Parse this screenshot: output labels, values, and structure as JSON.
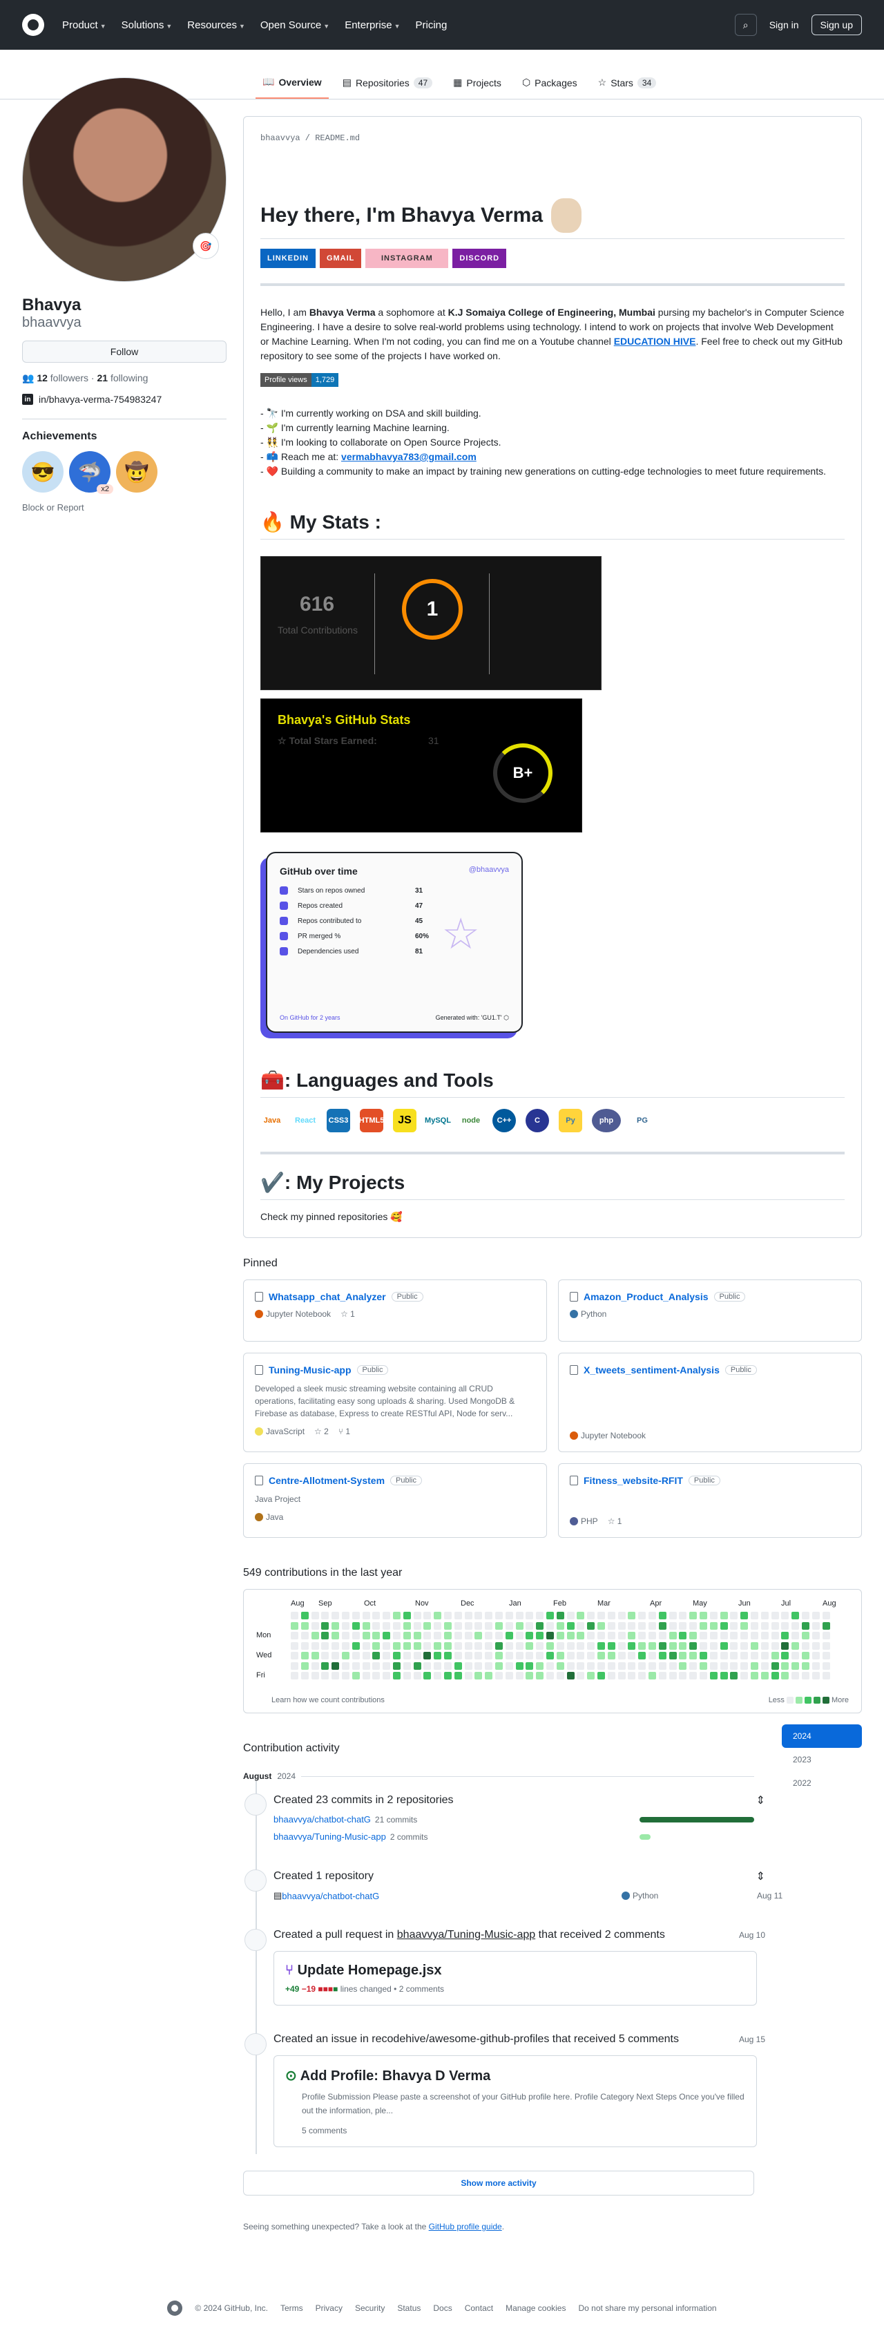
{
  "nav": {
    "items": [
      "Product",
      "Solutions",
      "Resources",
      "Open Source",
      "Enterprise",
      "Pricing"
    ],
    "signin": "Sign in",
    "signup": "Sign up"
  },
  "tabs": [
    {
      "label": "Overview",
      "count": ""
    },
    {
      "label": "Repositories",
      "count": "47"
    },
    {
      "label": "Projects",
      "count": ""
    },
    {
      "label": "Packages",
      "count": ""
    },
    {
      "label": "Stars",
      "count": "34"
    }
  ],
  "profile": {
    "name": "Bhavya",
    "login": "bhaavvya",
    "follow": "Follow",
    "followers": "12",
    "followers_label": "followers",
    "following": "21",
    "following_label": "following",
    "linkedin": "in/bhavya-verma-754983247",
    "achievements_title": "Achievements",
    "ach_count": "x2",
    "block": "Block or Report"
  },
  "readme": {
    "path_user": "bhaavvya",
    "path_file": "README",
    "path_ext": ".md",
    "title": "Hey there, I'm Bhavya Verma",
    "badges": [
      {
        "label": "LINKEDIN",
        "color": "#0a66c2"
      },
      {
        "label": "GMAIL",
        "color": "#d14836"
      },
      {
        "label": "INSTAGRAM",
        "color": "#f7b6c5"
      },
      {
        "label": "DISCORD",
        "color": "#7b1fa2"
      }
    ],
    "intro_1": "Hello, I am ",
    "intro_name": "Bhavya Verma",
    "intro_2": " a sophomore at ",
    "intro_college": "K.J Somaiya College of Engineering, Mumbai",
    "intro_3": " pursing my bachelor's in Computer Science Engineering. I have a desire to solve real-world problems using technology. I intend to work on projects that involve Web Development or Machine Learning. When I'm not coding, you can find me on a Youtube channel ",
    "intro_channel": "EDUCATION HIVE",
    "intro_4": ". Feel free to check out my GitHub repository to see some of the projects I have worked on.",
    "views_label": "Profile views",
    "views_value": "1,729",
    "bullets": [
      "- 🔭 I'm currently working on DSA and skill building.",
      "- 🌱 I'm currently learning Machine learning.",
      "- 👯 I'm looking to collaborate on Open Source Projects.",
      "- 📫 Reach me at: ",
      "- ❤️ Building a community to make an impact by training new generations on cutting-edge technologies to meet future requirements."
    ],
    "email": "vermabhavya783@gmail.com",
    "stats_title": "🔥 My Stats :",
    "streak_total": "616",
    "streak_label": "Total Contributions",
    "streak_current": "1",
    "gh_title": "Bhavya's GitHub Stats",
    "gh_stars_label": "Total Stars Earned:",
    "gh_stars_value": "31",
    "gh_grade": "B+",
    "ot_title": "GitHub over time",
    "ot_user": "@bhaavvya",
    "ot_rows": [
      {
        "label": "Stars on repos owned",
        "value": "31"
      },
      {
        "label": "Repos created",
        "value": "47"
      },
      {
        "label": "Repos contributed to",
        "value": "45"
      },
      {
        "label": "PR merged %",
        "value": "60%"
      },
      {
        "label": "Dependencies used",
        "value": "81"
      }
    ],
    "ot_foot_left": "On GitHub for 2 years",
    "ot_foot_right": "Generated with: 'GU1.T' ⬡",
    "langs_title": "🧰: Languages and Tools",
    "langs": [
      {
        "name": "Java",
        "color": "#e76f00"
      },
      {
        "name": "React",
        "color": "#61dafb"
      },
      {
        "name": "CSS3",
        "color": "#1572b6"
      },
      {
        "name": "HTML5",
        "color": "#e34f26"
      },
      {
        "name": "JS",
        "color": "#f7df1e"
      },
      {
        "name": "MySQL",
        "color": "#00758f"
      },
      {
        "name": "node",
        "color": "#3c873a"
      },
      {
        "name": "C++",
        "color": "#00599c"
      },
      {
        "name": "C",
        "color": "#283593"
      },
      {
        "name": "Py",
        "color": "#ffd43b"
      },
      {
        "name": "php",
        "color": "#4f5b93"
      },
      {
        "name": "PG",
        "color": "#336791"
      }
    ],
    "projects_title": "✔️: My Projects",
    "projects_text": "Check my pinned repositories 🥰"
  },
  "pinned_title": "Pinned",
  "pinned": [
    {
      "name": "Whatsapp_chat_Analyzer",
      "badge": "Public",
      "desc": "",
      "lang": "Jupyter Notebook",
      "lang_color": "#da5b0b",
      "stars": "1",
      "forks": ""
    },
    {
      "name": "Amazon_Product_Analysis",
      "badge": "Public",
      "desc": "",
      "lang": "Python",
      "lang_color": "#3572a5",
      "stars": "",
      "forks": ""
    },
    {
      "name": "Tuning-Music-app",
      "badge": "Public",
      "desc": "Developed a sleek music streaming website containing all CRUD operations, facilitating easy song uploads & sharing. Used MongoDB & Firebase as database, Express to create RESTful API, Node for serv...",
      "lang": "JavaScript",
      "lang_color": "#f1e05a",
      "stars": "2",
      "forks": "1"
    },
    {
      "name": "X_tweets_sentiment-Analysis",
      "badge": "Public",
      "desc": "",
      "lang": "Jupyter Notebook",
      "lang_color": "#da5b0b",
      "stars": "",
      "forks": ""
    },
    {
      "name": "Centre-Allotment-System",
      "badge": "Public",
      "desc": "Java Project",
      "lang": "Java",
      "lang_color": "#b07219",
      "stars": "",
      "forks": ""
    },
    {
      "name": "Fitness_website-RFIT",
      "badge": "Public",
      "desc": "",
      "lang": "PHP",
      "lang_color": "#4f5d95",
      "stars": "1",
      "forks": ""
    }
  ],
  "contrib": {
    "title": "549 contributions in the last year",
    "months": [
      "Aug",
      "Sep",
      "Oct",
      "Nov",
      "Dec",
      "Jan",
      "Feb",
      "Mar",
      "Apr",
      "May",
      "Jun",
      "Jul",
      "Aug"
    ],
    "days": [
      "Mon",
      "Wed",
      "Fri"
    ],
    "learn": "Learn how we count contributions",
    "less": "Less",
    "more": "More"
  },
  "activity": {
    "title": "Contribution activity",
    "month": "August",
    "year": "2024",
    "years": [
      "2024",
      "2023",
      "2022"
    ],
    "ev1_title": "Created 23 commits in 2 repositories",
    "ev1_repos": [
      {
        "name": "bhaavvya/chatbot-chatG",
        "sub": "21 commits"
      },
      {
        "name": "bhaavvya/Tuning-Music-app",
        "sub": "2 commits"
      }
    ],
    "ev2_title": "Created 1 repository",
    "ev2_repo": "bhaavvya/chatbot-chatG",
    "ev2_lang": "Python",
    "ev2_date": "Aug 11",
    "ev3_title_1": "Created a pull request in ",
    "ev3_repo": "bhaavvya/Tuning-Music-app",
    "ev3_title_2": " that received 2 comments",
    "ev3_date": "Aug 10",
    "ev3_pr": "Update Homepage.jsx",
    "ev3_add": "+49",
    "ev3_del": "−19",
    "ev3_lines": "lines changed",
    "ev3_comments": "• 2 comments",
    "ev4_title": "Created an issue in recodehive/awesome-github-profiles that received 5 comments",
    "ev4_date": "Aug 15",
    "ev4_issue": "Add Profile: Bhavya D Verma",
    "ev4_body": "Profile Submission Please paste a screenshot of your GitHub profile here. Profile Category Next Steps Once you've filled out the information, ple...",
    "ev4_comments": "5 comments",
    "show_more": "Show more activity",
    "unexpected_1": "Seeing something unexpected? Take a look at the ",
    "unexpected_link": "GitHub profile guide",
    "unexpected_2": "."
  },
  "footer": [
    "© 2024 GitHub, Inc.",
    "Terms",
    "Privacy",
    "Security",
    "Status",
    "Docs",
    "Contact",
    "Manage cookies",
    "Do not share my personal information"
  ]
}
